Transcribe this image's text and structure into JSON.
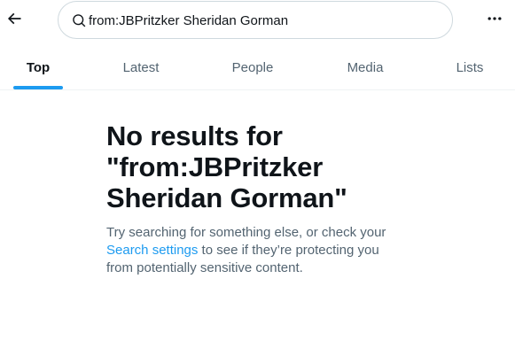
{
  "search": {
    "value": "from:JBPritzker Sheridan Gorman",
    "placeholder": "Search"
  },
  "tabs": [
    {
      "label": "Top",
      "active": true
    },
    {
      "label": "Latest",
      "active": false
    },
    {
      "label": "People",
      "active": false
    },
    {
      "label": "Media",
      "active": false
    },
    {
      "label": "Lists",
      "active": false
    }
  ],
  "empty_state": {
    "title": "No results for \"from:JBPritzker Sheridan Gorman\"",
    "desc_before": "Try searching for something else, or check your ",
    "link_text": "Search settings",
    "desc_after": " to see if they’re protecting you from potentially sensitive content."
  },
  "icons": {
    "back": "arrow-left-icon",
    "search": "search-icon",
    "more": "more-horizontal-icon"
  },
  "colors": {
    "accent": "#1d9bf0",
    "text_primary": "#0f1419",
    "text_secondary": "#536471",
    "border": "#cfd9de"
  }
}
